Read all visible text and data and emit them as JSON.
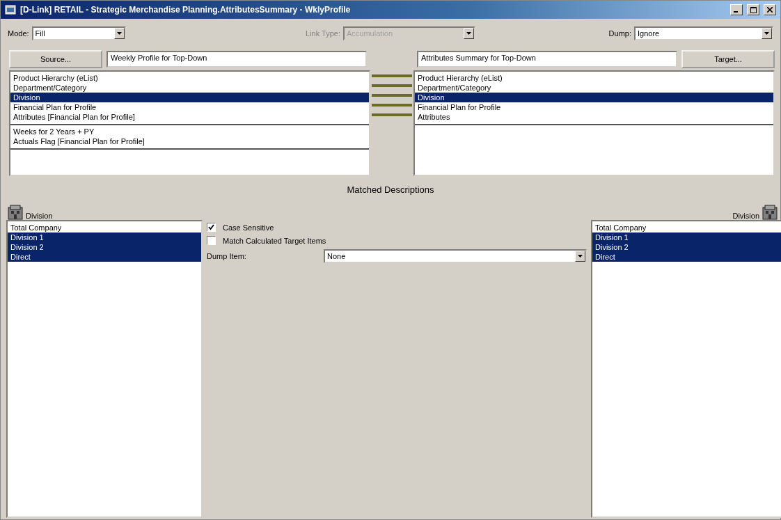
{
  "window": {
    "title": "[D-Link] RETAIL - Strategic Merchandise Planning.AttributesSummary - WklyProfile"
  },
  "toolbar": [
    {
      "label": "Mode:",
      "value": "Fill",
      "disabled": false
    },
    {
      "label": "Link Type:",
      "value": "Accumulation",
      "disabled": true
    },
    {
      "label": "Dump:",
      "value": "Ignore",
      "disabled": false
    }
  ],
  "source": {
    "button": "Source...",
    "value": "Weekly Profile for Top-Down"
  },
  "target": {
    "button": "Target...",
    "value": "Attributes Summary for Top-Down"
  },
  "source_list": [
    {
      "items": [
        {
          "label": "Product Hierarchy (eList)",
          "selected": false
        },
        {
          "label": "Department/Category",
          "selected": false
        },
        {
          "label": "Division",
          "selected": true
        },
        {
          "label": "Financial Plan for Profile",
          "selected": false
        },
        {
          "label": "Attributes [Financial Plan for Profile]",
          "selected": false
        }
      ]
    },
    {
      "items": [
        {
          "label": "Weeks for 2 Years + PY",
          "selected": false
        },
        {
          "label": "Actuals Flag [Financial Plan for Profile]",
          "selected": false
        }
      ]
    }
  ],
  "target_list": [
    {
      "items": [
        {
          "label": "Product Hierarchy (eList)",
          "selected": false
        },
        {
          "label": "Department/Category",
          "selected": false
        },
        {
          "label": "Division",
          "selected": true
        },
        {
          "label": "Financial Plan for Profile",
          "selected": false
        },
        {
          "label": "Attributes",
          "selected": false
        }
      ]
    }
  ],
  "matched_title": "Matched Descriptions",
  "left_dimension": {
    "label": "Division",
    "items": [
      {
        "label": "Total Company",
        "selected": false
      },
      {
        "label": "Division 1",
        "selected": true
      },
      {
        "label": "Division 2",
        "selected": true
      },
      {
        "label": "Direct",
        "selected": true
      }
    ]
  },
  "options": [
    {
      "label": "Case Sensitive",
      "checked": true
    },
    {
      "label": "Match Calculated Target Items",
      "checked": false
    }
  ],
  "dump_item": {
    "label": "Dump Item:",
    "value": "None"
  },
  "right_dimension": {
    "label": "Division",
    "items": [
      {
        "label": "Total Company",
        "selected": false
      },
      {
        "label": "Division 1",
        "selected": true
      },
      {
        "label": "Division 2",
        "selected": true
      },
      {
        "label": "Direct",
        "selected": true
      }
    ]
  }
}
